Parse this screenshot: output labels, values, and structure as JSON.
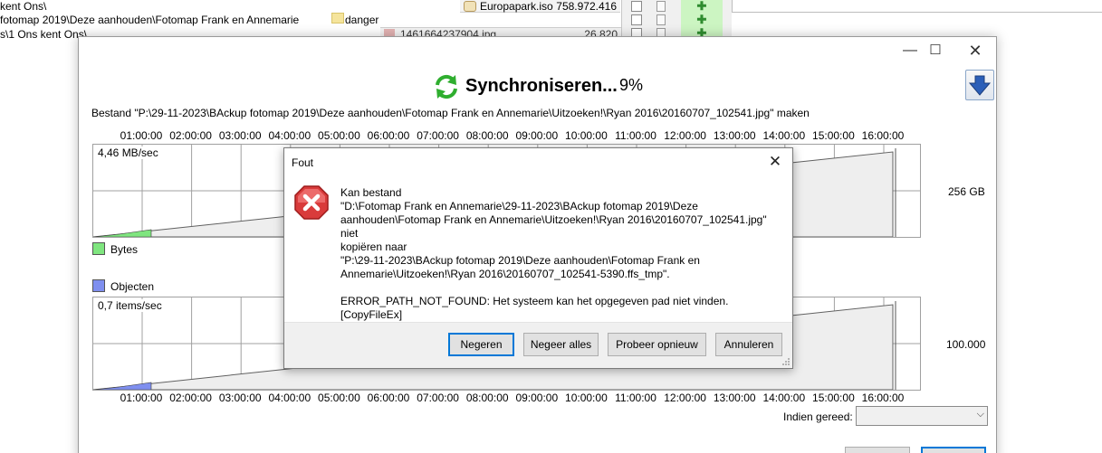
{
  "background": {
    "line1": "kent Ons\\",
    "line2": " fotomap 2019\\Deze aanhouden\\Fotomap Frank en Annemarie",
    "line3": "s\\1 Ons kent Ons\\",
    "folder_name": "danger",
    "file1": {
      "name": "Europapark.iso",
      "size": "758.972.416"
    },
    "file2": {
      "name": "1461664237904.jpg",
      "size": "26.820"
    }
  },
  "window": {
    "title": "Synchroniseren...",
    "percent": "9%",
    "status_line": "Bestand \"P:\\29-11-2023\\BAckup fotomap 2019\\Deze aanhouden\\Fotomap Frank en Annemarie\\Uitzoeken!\\Ryan 2016\\20160707_102541.jpg\" maken",
    "time_labels": [
      "01:00:00",
      "02:00:00",
      "03:00:00",
      "04:00:00",
      "05:00:00",
      "06:00:00",
      "07:00:00",
      "08:00:00",
      "09:00:00",
      "10:00:00",
      "11:00:00",
      "12:00:00",
      "13:00:00",
      "14:00:00",
      "15:00:00",
      "16:00:00"
    ],
    "bytes_graph": {
      "rate": "4,46 MB/sec",
      "total": "256 GB",
      "legend": "Bytes",
      "color": "#7fe57f"
    },
    "objects_graph": {
      "rate": "0,7 items/sec",
      "total": "100.000",
      "legend": "Objecten",
      "color": "#7f8fef"
    },
    "when_done_label": "Indien gereed:",
    "when_done_value": ""
  },
  "dialog": {
    "title": "Fout",
    "message_lines": [
      "Kan bestand",
      "\"D:\\Fotomap Frank en Annemarie\\29-11-2023\\BAckup fotomap 2019\\Deze",
      "aanhouden\\Fotomap Frank en Annemarie\\Uitzoeken!\\Ryan 2016\\20160707_102541.jpg\" niet",
      "kopiëren naar",
      "\"P:\\29-11-2023\\BAckup fotomap 2019\\Deze aanhouden\\Fotomap Frank en",
      "Annemarie\\Uitzoeken!\\Ryan 2016\\20160707_102541-5390.ffs_tmp\"."
    ],
    "error_detail": "ERROR_PATH_NOT_FOUND: Het systeem kan het opgegeven pad niet vinden. [CopyFileEx]",
    "buttons": {
      "ignore": "Negeren",
      "ignore_all": "Negeer alles",
      "retry": "Probeer opnieuw",
      "cancel": "Annuleren"
    },
    "accent_color": "#0078d7"
  }
}
